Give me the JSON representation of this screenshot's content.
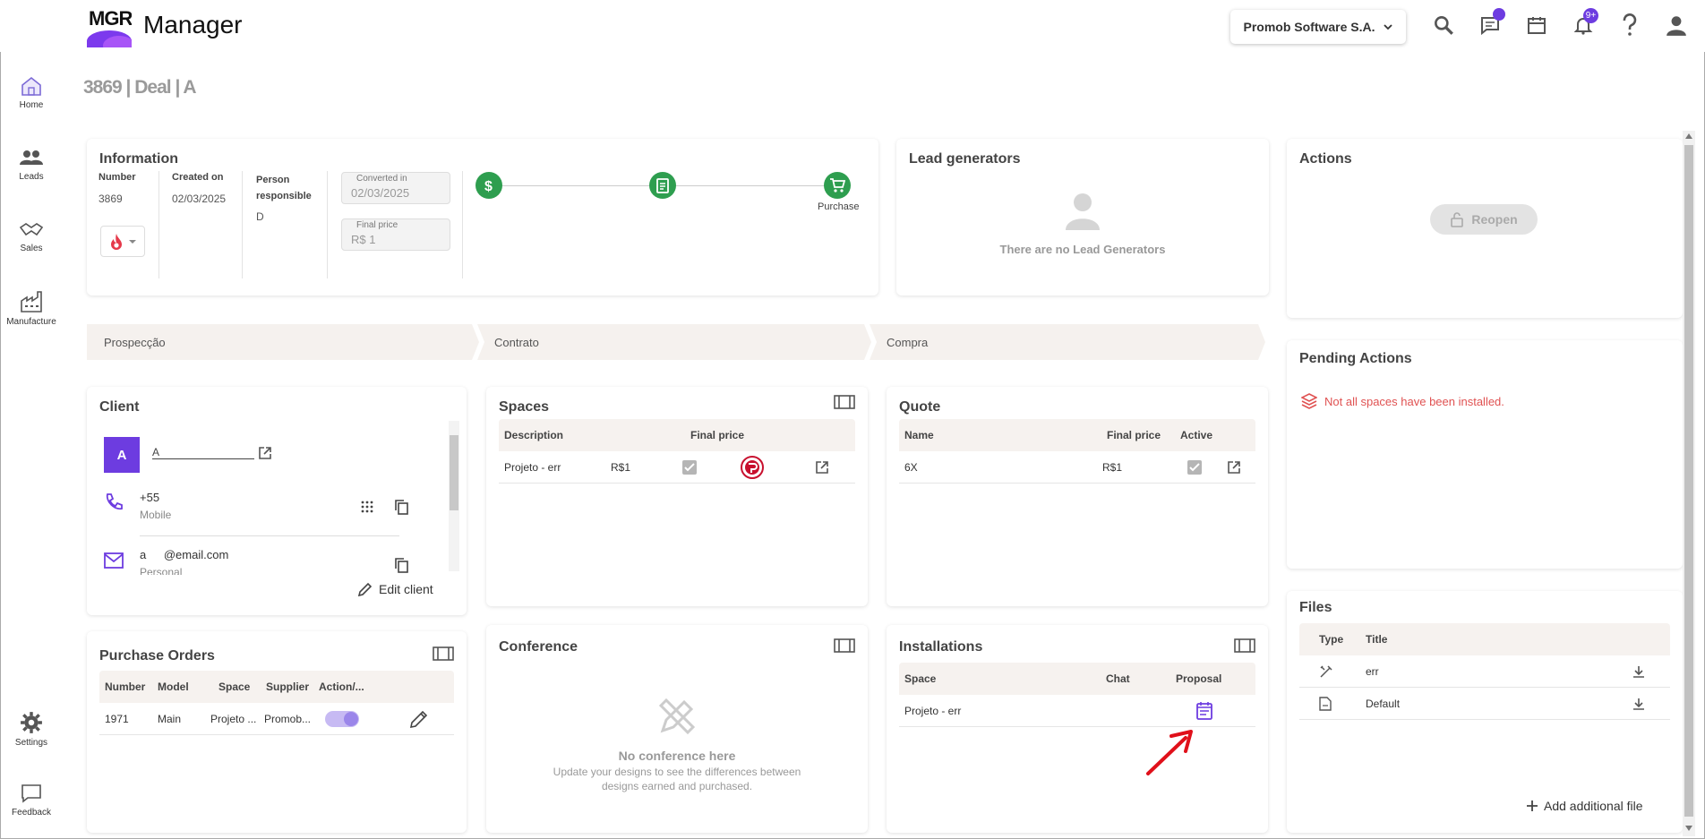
{
  "app": {
    "logo_text": "MGR",
    "title": "Manager"
  },
  "header": {
    "company": "Promob Software S.A.",
    "notification_badge": "9+"
  },
  "sidebar": {
    "items": [
      {
        "label": "Home"
      },
      {
        "label": "Leads"
      },
      {
        "label": "Sales"
      },
      {
        "label": "Manufacture"
      },
      {
        "label": "Settings"
      },
      {
        "label": "Feedback"
      }
    ]
  },
  "page": {
    "heading": "3869 | Deal | A"
  },
  "information": {
    "title": "Information",
    "number_label": "Number",
    "number_value": "3869",
    "created_label": "Created on",
    "created_value": "02/03/2025",
    "person_label": "Person responsible",
    "person_value": "D",
    "converted_label": "Converted in",
    "converted_value": "02/03/2025",
    "final_price_label": "Final price",
    "final_price_value": "R$ 1",
    "stage_label": "Purchase"
  },
  "lead_generators": {
    "title": "Lead generators",
    "empty": "There are no Lead Generators"
  },
  "actions": {
    "title": "Actions",
    "reopen": "Reopen"
  },
  "phases": [
    "Prospecção",
    "Contrato",
    "Compra"
  ],
  "client": {
    "title": "Client",
    "avatar_letter": "A",
    "name": "A",
    "phone": "+55",
    "phone_type": "Mobile",
    "email_user": "a",
    "email_domain": "@email.com",
    "email_type": "Personal",
    "edit": "Edit client"
  },
  "spaces": {
    "title": "Spaces",
    "headers": [
      "Description",
      "Final price"
    ],
    "rows": [
      {
        "description": "Projeto - err",
        "price": "R$1"
      }
    ]
  },
  "quote": {
    "title": "Quote",
    "headers": [
      "Name",
      "Final price",
      "Active"
    ],
    "rows": [
      {
        "name": "6X",
        "price": "R$1"
      }
    ]
  },
  "pending": {
    "title": "Pending Actions",
    "item": "Not all spaces have been installed."
  },
  "purchase_orders": {
    "title": "Purchase Orders",
    "headers": [
      "Number",
      "Model",
      "Space",
      "Supplier",
      "Action/..."
    ],
    "rows": [
      {
        "number": "1971",
        "model": "Main",
        "space": "Projeto ...",
        "supplier": "Promob..."
      }
    ]
  },
  "conference": {
    "title": "Conference",
    "empty_title": "No conference here",
    "empty_text": "Update your designs to see the differences between designs earned and purchased."
  },
  "installations": {
    "title": "Installations",
    "headers": [
      "Space",
      "Chat",
      "Proposal"
    ],
    "rows": [
      {
        "space": "Projeto - err"
      }
    ]
  },
  "files": {
    "title": "Files",
    "headers": [
      "Type",
      "Title"
    ],
    "rows": [
      {
        "title": "err"
      },
      {
        "title": "Default"
      }
    ],
    "add": "Add additional file"
  },
  "colors": {
    "accent": "#6d3ce0",
    "green": "#2e9e4f",
    "warning": "#e05252"
  }
}
